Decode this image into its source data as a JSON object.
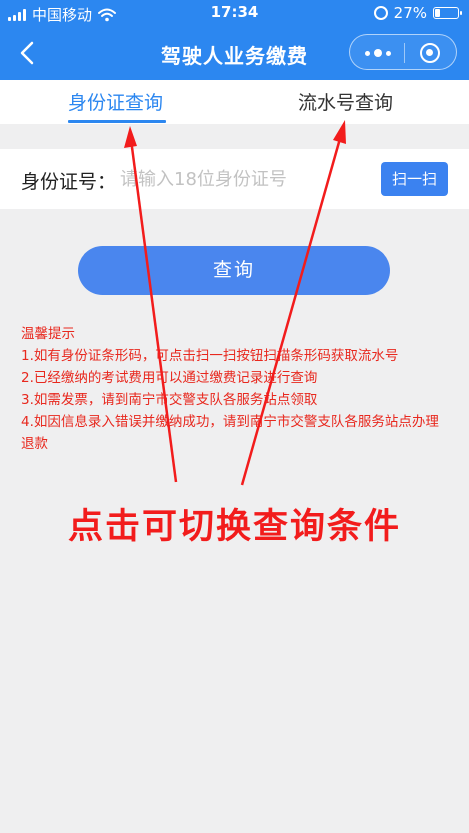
{
  "status_bar": {
    "carrier": "中国移动",
    "time": "17:34",
    "battery_text": "27%",
    "battery_level": 0.27
  },
  "navbar": {
    "title": "驾驶人业务缴费"
  },
  "tabs": [
    {
      "label": "身份证查询",
      "active": true
    },
    {
      "label": "流水号查询",
      "active": false
    }
  ],
  "form": {
    "id_label": "身份证号：",
    "id_placeholder": "请输入18位身份证号",
    "scan_label": "扫一扫",
    "query_label": "查询"
  },
  "tips": {
    "title": "温馨提示",
    "items": [
      "1.如有身份证条形码，可点击扫一扫按钮扫描条形码获取流水号",
      "2.已经缴纳的考试费用可以通过缴费记录进行查询",
      "3.如需发票，请到南宁市交警支队各服务站点领取",
      "4.如因信息录入错误并缴纳成功，请到南宁市交警支队各服务站点办理退款"
    ]
  },
  "annotation": {
    "text": "点击可切换查询条件"
  },
  "colors": {
    "brand_blue": "#2c87f0",
    "tip_red": "#e8281e",
    "annotation_red": "#f21c1c"
  }
}
